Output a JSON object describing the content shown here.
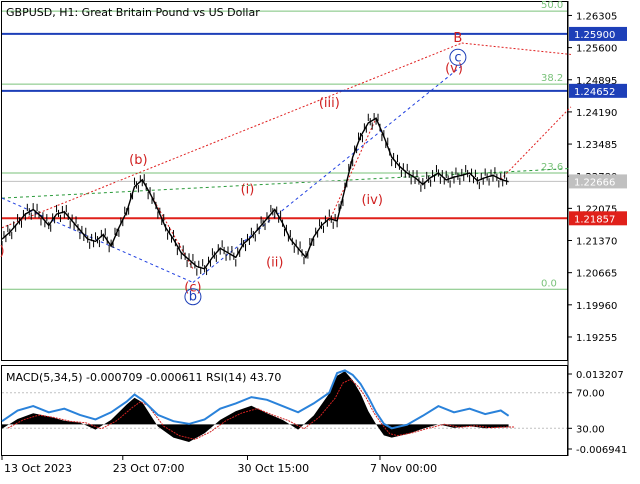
{
  "chart_data": {
    "type": "line",
    "title": "GBPUSD, H1:  Great Britain Pound vs US Dollar",
    "price_axis": {
      "ylim": [
        1.1875,
        1.266
      ],
      "ticks": [
        "1.26305",
        "1.25600",
        "1.24895",
        "1.24190",
        "1.23485",
        "1.22780",
        "1.22075",
        "1.21370",
        "1.20665",
        "1.19960",
        "1.19255"
      ]
    },
    "x_labels": [
      "13 Oct 2023",
      "23 Oct 07:00",
      "30 Oct 15:00",
      "7 Nov 00:00"
    ],
    "x_label_slots": [
      0,
      31,
      63,
      97
    ],
    "slots": 146,
    "price_path": [
      [
        0,
        1.214
      ],
      [
        2,
        1.2155
      ],
      [
        4,
        1.2175
      ],
      [
        6,
        1.2195
      ],
      [
        8,
        1.2205
      ],
      [
        10,
        1.219
      ],
      [
        12,
        1.217
      ],
      [
        14,
        1.2195
      ],
      [
        16,
        1.22
      ],
      [
        18,
        1.218
      ],
      [
        20,
        1.216
      ],
      [
        22,
        1.214
      ],
      [
        24,
        1.2135
      ],
      [
        26,
        1.215
      ],
      [
        28,
        1.2125
      ],
      [
        30,
        1.2165
      ],
      [
        32,
        1.22
      ],
      [
        34,
        1.2255
      ],
      [
        36,
        1.227
      ],
      [
        38,
        1.224
      ],
      [
        40,
        1.2205
      ],
      [
        42,
        1.2165
      ],
      [
        44,
        1.214
      ],
      [
        46,
        1.211
      ],
      [
        48,
        1.2095
      ],
      [
        50,
        1.208
      ],
      [
        52,
        1.2075
      ],
      [
        54,
        1.21
      ],
      [
        56,
        1.212
      ],
      [
        58,
        1.211
      ],
      [
        60,
        1.21
      ],
      [
        62,
        1.213
      ],
      [
        64,
        1.2145
      ],
      [
        66,
        1.2165
      ],
      [
        68,
        1.2185
      ],
      [
        70,
        1.2205
      ],
      [
        72,
        1.2175
      ],
      [
        74,
        1.214
      ],
      [
        76,
        1.212
      ],
      [
        78,
        1.21
      ],
      [
        80,
        1.2145
      ],
      [
        82,
        1.217
      ],
      [
        84,
        1.2185
      ],
      [
        86,
        1.218
      ],
      [
        88,
        1.225
      ],
      [
        90,
        1.232
      ],
      [
        92,
        1.2365
      ],
      [
        94,
        1.2395
      ],
      [
        96,
        1.2405
      ],
      [
        98,
        1.2365
      ],
      [
        100,
        1.232
      ],
      [
        102,
        1.23
      ],
      [
        104,
        1.2285
      ],
      [
        106,
        1.2275
      ],
      [
        108,
        1.226
      ],
      [
        110,
        1.2275
      ],
      [
        112,
        1.2285
      ],
      [
        114,
        1.227
      ],
      [
        116,
        1.2276
      ],
      [
        118,
        1.228
      ],
      [
        120,
        1.2285
      ],
      [
        122,
        1.2268
      ],
      [
        124,
        1.2275
      ],
      [
        126,
        1.228
      ],
      [
        128,
        1.2271
      ],
      [
        130,
        1.2266
      ]
    ],
    "levels": [
      {
        "value": "1.25900",
        "price": 1.259,
        "color": "#1d3fb8",
        "label_bg": "#1d3fb8",
        "label_fg": "#ffffff"
      },
      {
        "value": "1.24652",
        "price": 1.24652,
        "color": "#1d3fb8",
        "label_bg": "#1d3fb8",
        "label_fg": "#ffffff"
      },
      {
        "value": "1.22666",
        "price": 1.22666,
        "color": "#c0c0c0",
        "label_bg": "#c0c0c0",
        "label_fg": "#ffffff"
      },
      {
        "value": "1.21857",
        "price": 1.21857,
        "color": "#e0201a",
        "label_bg": "#e0201a",
        "label_fg": "#ffffff"
      }
    ],
    "fib_levels": [
      {
        "label": "50.0",
        "price": 1.264
      },
      {
        "label": "38.2",
        "price": 1.248
      },
      {
        "label": "23.6",
        "price": 1.2285
      },
      {
        "label": "0.0",
        "price": 1.203
      }
    ],
    "wave_labels": [
      {
        "text": "(b)",
        "slot": 35,
        "price": 1.2305,
        "color": "#d02020"
      },
      {
        "text": "(c)",
        "slot": 49,
        "price": 1.2025,
        "color": "#d02020"
      },
      {
        "text": "b",
        "slot": 49,
        "price": 1.2005,
        "color": "#1d3fb8",
        "circled": true
      },
      {
        "text": "(i)",
        "slot": 63,
        "price": 1.224,
        "color": "#d02020"
      },
      {
        "text": "(ii)",
        "slot": 70,
        "price": 1.208,
        "color": "#d02020"
      },
      {
        "text": "(iii)",
        "slot": 84,
        "price": 1.243,
        "color": "#d02020"
      },
      {
        "text": "(iv)",
        "slot": 95,
        "price": 1.2217,
        "color": "#d02020"
      },
      {
        "text": "(v)",
        "slot": 116,
        "price": 1.2505,
        "color": "#d02020"
      },
      {
        "text": "c",
        "slot": 117,
        "price": 1.253,
        "color": "#1d3fb8",
        "circled": true
      },
      {
        "text": "B",
        "slot": 117,
        "price": 1.2572,
        "color": "#d02020"
      },
      {
        "text": ")",
        "slot": 0,
        "price": 1.2105,
        "color": "#d02020"
      }
    ],
    "indicator": {
      "title": "MACD(5,34,5) -0.000709 -0.000611 RSI(14) 43.70",
      "ticks": [
        "0.013207",
        "70.00",
        "30.00",
        "-0.006941"
      ],
      "rsi_ylim": [
        0,
        100
      ],
      "macd_ylim": [
        -0.006941,
        0.013207
      ],
      "rsi": [
        [
          0,
          38
        ],
        [
          4,
          50
        ],
        [
          8,
          55
        ],
        [
          12,
          48
        ],
        [
          16,
          52
        ],
        [
          20,
          45
        ],
        [
          24,
          40
        ],
        [
          28,
          48
        ],
        [
          32,
          60
        ],
        [
          34,
          68
        ],
        [
          36,
          62
        ],
        [
          40,
          45
        ],
        [
          44,
          38
        ],
        [
          48,
          35
        ],
        [
          52,
          40
        ],
        [
          56,
          52
        ],
        [
          60,
          58
        ],
        [
          64,
          65
        ],
        [
          68,
          62
        ],
        [
          72,
          55
        ],
        [
          76,
          48
        ],
        [
          80,
          58
        ],
        [
          84,
          70
        ],
        [
          86,
          92
        ],
        [
          88,
          95
        ],
        [
          90,
          90
        ],
        [
          92,
          80
        ],
        [
          94,
          65
        ],
        [
          96,
          48
        ],
        [
          98,
          35
        ],
        [
          100,
          30
        ],
        [
          104,
          34
        ],
        [
          108,
          44
        ],
        [
          112,
          55
        ],
        [
          116,
          48
        ],
        [
          120,
          52
        ],
        [
          124,
          46
        ],
        [
          128,
          50
        ],
        [
          130,
          44
        ]
      ],
      "macd": [
        [
          0,
          -0.001
        ],
        [
          4,
          0.0012
        ],
        [
          8,
          0.0025
        ],
        [
          12,
          0.0018
        ],
        [
          16,
          0.0008
        ],
        [
          20,
          0.0004
        ],
        [
          24,
          -0.0012
        ],
        [
          28,
          0.001
        ],
        [
          32,
          0.0045
        ],
        [
          34,
          0.006
        ],
        [
          36,
          0.005
        ],
        [
          40,
          -0.0005
        ],
        [
          44,
          -0.003
        ],
        [
          48,
          -0.004
        ],
        [
          52,
          -0.002
        ],
        [
          56,
          0.001
        ],
        [
          60,
          0.003
        ],
        [
          64,
          0.0042
        ],
        [
          68,
          0.0025
        ],
        [
          72,
          0.001
        ],
        [
          76,
          -0.0012
        ],
        [
          80,
          0.002
        ],
        [
          84,
          0.007
        ],
        [
          86,
          0.011
        ],
        [
          88,
          0.012
        ],
        [
          90,
          0.01
        ],
        [
          92,
          0.007
        ],
        [
          94,
          0.003
        ],
        [
          96,
          0.0
        ],
        [
          98,
          -0.0025
        ],
        [
          100,
          -0.003
        ],
        [
          104,
          -0.0022
        ],
        [
          108,
          -0.001
        ],
        [
          112,
          0.0
        ],
        [
          116,
          -0.0008
        ],
        [
          120,
          -0.0004
        ],
        [
          124,
          -0.0009
        ],
        [
          128,
          -0.0007
        ],
        [
          130,
          -0.0007
        ]
      ]
    }
  },
  "colors": {
    "price": "#000000",
    "rsi": "#2a82da",
    "macd_signal": "#d02020",
    "grid_dot": "#c0c0c0",
    "trend_green": "#2a9a3a",
    "trend_red": "#e02020",
    "trend_blue": "#2040e0",
    "fib_line": "#7ac27a"
  }
}
